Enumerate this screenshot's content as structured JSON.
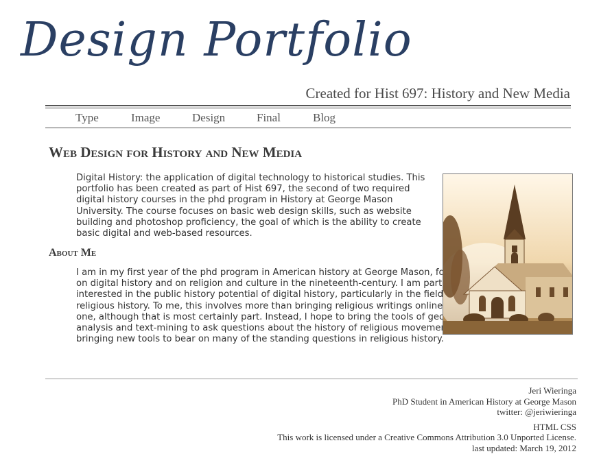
{
  "header": {
    "title": "Design Portfolio",
    "subtitle": "Created for Hist 697: History and New Media"
  },
  "nav": {
    "items": [
      "Type",
      "Image",
      "Design",
      "Final",
      "Blog"
    ]
  },
  "main": {
    "heading": "Web Design for History and New Media",
    "intro": "Digital History: the application of digital technology to historical studies. This portfolio has been created as part of Hist 697, the second of two required digital history courses in the phd program in History at George Mason University. The course focuses on basic web design skills, such as website building and photoshop proficiency, the goal of which is the ability to create basic digital and web-based resources.",
    "about_heading": "About Me",
    "about": "I am in my first year of the phd program in American history at George Mason, focusing on digital history and on religion and culture in the nineteenth-century. I am particularly interested in the public history potential of digital history, particularly in the field of religious history. To me, this involves more than bringing religious writings online for one, although that is most certainly part. Instead, I hope to bring the tools of geospatial analysis and text-mining to ask questions about the history of religious movements, bringing new tools to bear on many of the standing questions in religious history."
  },
  "colors": {
    "title": "#2a3f63",
    "sepia_light": "#fff7e8",
    "sepia_dark": "#a07640"
  },
  "footer": {
    "name": "Jeri Wieringa",
    "role": "PhD Student in American History at George Mason",
    "twitter": "twitter: @jeriwieringa",
    "html_link": "HTML",
    "css_link": "CSS",
    "license_prefix": "This work is licensed under a ",
    "license_link": "Creative Commons Attribution 3.0 Unported License",
    "license_suffix": ".",
    "updated": "last updated: March 19, 2012"
  }
}
